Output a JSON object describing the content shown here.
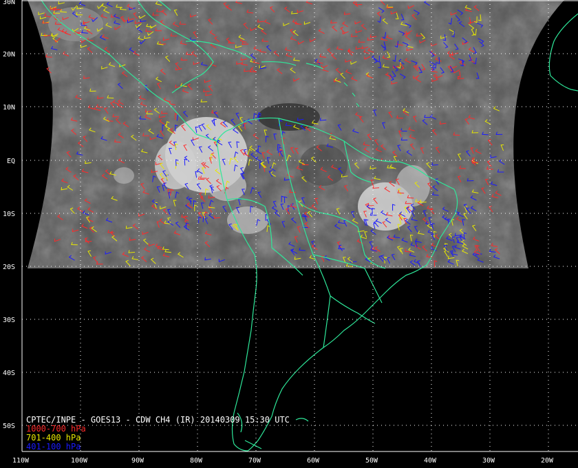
{
  "title": "CPTEC/INPE - GOES13 - CDW CH4 (IR) 20140309 15:30 UTC",
  "legend": [
    {
      "label": "1000-700 hPa",
      "color": "#ff2a2a"
    },
    {
      "label": "701-400 hPa",
      "color": "#e8e800"
    },
    {
      "label": "401-100 hPa",
      "color": "#1a1aff"
    }
  ],
  "colors": {
    "background": "#000000",
    "coast": "#2ee89a",
    "grid": "#ffffff",
    "cloud": "#5a5a5a"
  },
  "lat_labels": [
    "30N",
    "20N",
    "10N",
    "EQ",
    "10S",
    "20S",
    "30S",
    "40S",
    "50S"
  ],
  "lon_labels": [
    "110W",
    "100W",
    "90W",
    "80W",
    "70W",
    "60W",
    "50W",
    "40W",
    "30W",
    "20W"
  ]
}
